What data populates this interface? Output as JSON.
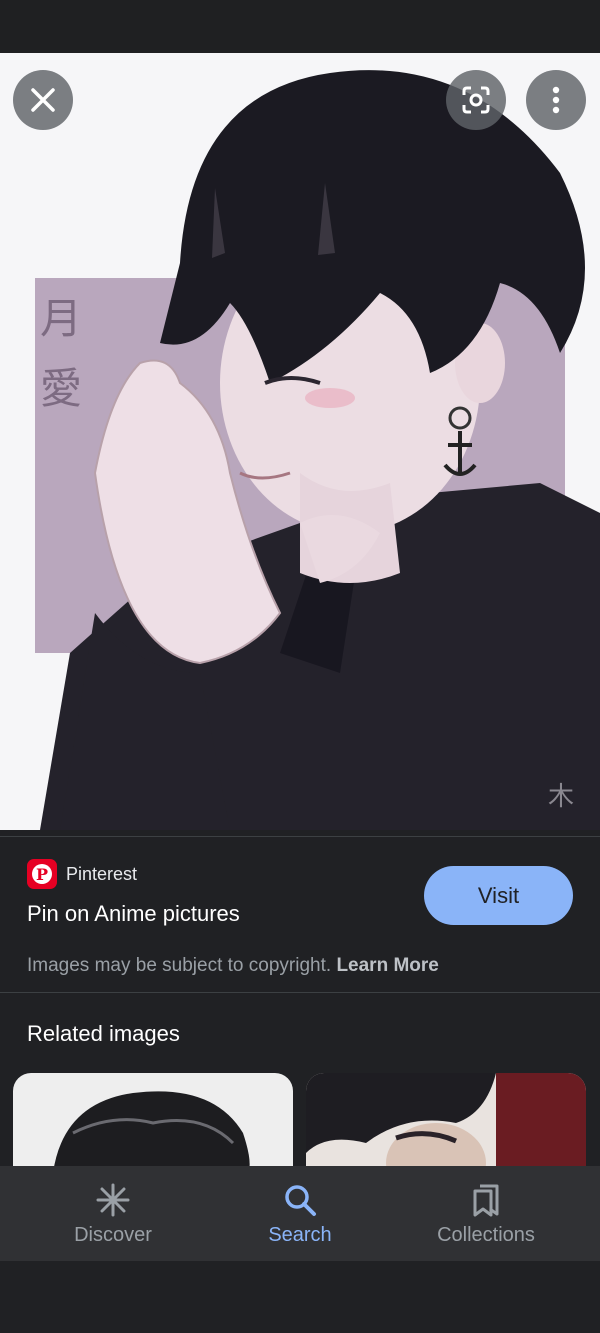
{
  "hero": {
    "watermark_text": "月愛",
    "signature_text": "木"
  },
  "icons": {
    "close": "close-icon",
    "lens": "google-lens-icon",
    "more": "more-vert-icon",
    "source_logo": "pinterest-logo-icon",
    "discover": "asterisk-icon",
    "search": "search-icon",
    "collections": "bookmarks-icon"
  },
  "source": {
    "name": "Pinterest",
    "title": "Pin on Anime pictures",
    "visit_label": "Visit"
  },
  "copyright": {
    "text": "Images may be subject to copyright. ",
    "link": "Learn More"
  },
  "related": {
    "title": "Related images"
  },
  "bottom_nav": {
    "items": [
      {
        "label": "Discover"
      },
      {
        "label": "Search"
      },
      {
        "label": "Collections"
      }
    ],
    "active": "Search"
  },
  "colors": {
    "accent": "#8ab4f8",
    "background": "#202124",
    "nav_background": "#303134",
    "pinterest_red": "#e60023"
  }
}
